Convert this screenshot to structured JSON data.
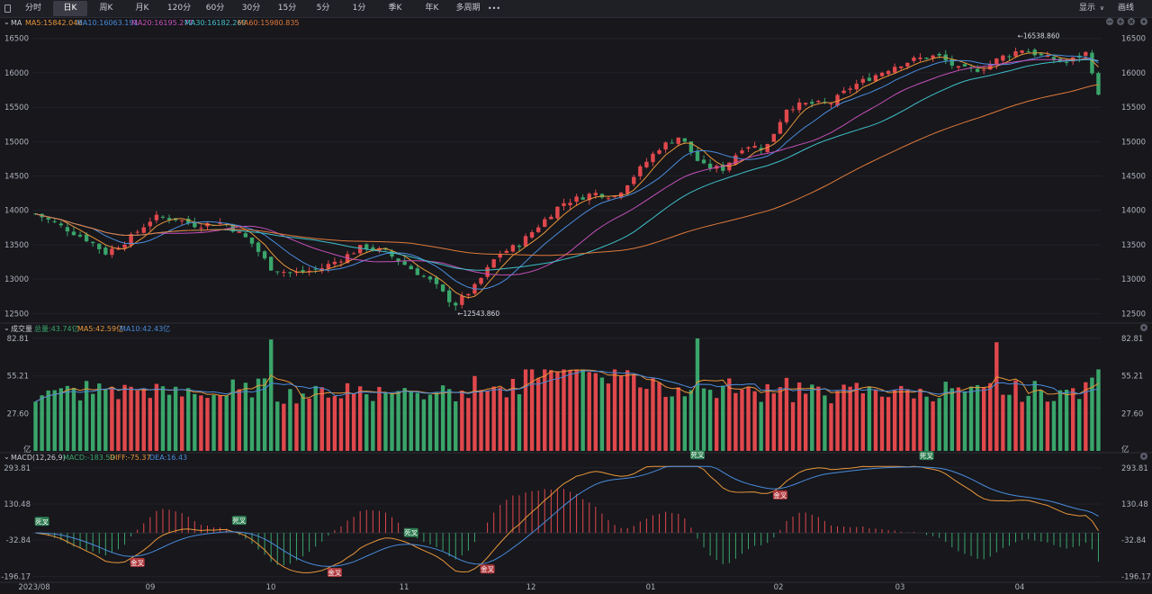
{
  "toolbar": {
    "tabs": [
      "分时",
      "日K",
      "周K",
      "月K",
      "120分",
      "60分",
      "30分",
      "15分",
      "5分",
      "1分",
      "季K",
      "年K",
      "多周期"
    ],
    "active": "日K",
    "more": "•••",
    "display": "显示",
    "display_arrow": "∨",
    "draw": "画线"
  },
  "colors": {
    "up": "#e0484c",
    "down": "#3aa56a",
    "ma5": "#e8963a",
    "ma10": "#4a8cdb",
    "ma20": "#c650b8",
    "ma30": "#40bfc9",
    "ma60": "#e07a3a",
    "bg": "#17171c"
  },
  "main": {
    "label": "MA",
    "legend": [
      {
        "text": "MA5:15842.046",
        "color": "#e8963a"
      },
      {
        "text": "MA10:16063.191",
        "color": "#4a8cdb"
      },
      {
        "text": "MA20:16195.277",
        "color": "#c650b8"
      },
      {
        "text": "MA30:16182.269",
        "color": "#40bfc9"
      },
      {
        "text": "MA60:15980.835",
        "color": "#e07a3a"
      }
    ],
    "yticks": [
      "16500",
      "16000",
      "15500",
      "15000",
      "14500",
      "14000",
      "13500",
      "13000",
      "12500"
    ],
    "high_label": "←16538.860",
    "low_label": "←12543.860"
  },
  "volume": {
    "label": "成交量",
    "legend": [
      {
        "text": "总量:43.74亿",
        "color": "#3aa56a"
      },
      {
        "text": "MA5:42.59亿",
        "color": "#e8963a"
      },
      {
        "text": "MA10:42.43亿",
        "color": "#4a8cdb"
      }
    ],
    "yticks": [
      "82.81",
      "55.21",
      "27.60"
    ],
    "unit": "亿"
  },
  "macd": {
    "label": "MACD(12,26,9)",
    "legend": [
      {
        "text": "MACD:-183.59",
        "color": "#3aa56a"
      },
      {
        "text": "DIFF:-75.37",
        "color": "#e8963a"
      },
      {
        "text": "DEA:16.43",
        "color": "#4a8cdb"
      }
    ],
    "yticks": [
      {
        "text": "293.81",
        "color": "#e0484c"
      },
      {
        "text": "130.48",
        "color": "#e0484c"
      },
      {
        "text": "-32.84",
        "color": "#3aa56a"
      },
      {
        "text": "-196.17",
        "color": "#3aa56a"
      }
    ],
    "gold": "金叉",
    "death": "死叉"
  },
  "xaxis": [
    "2023/08",
    "09",
    "10",
    "11",
    "12",
    "01",
    "02",
    "03",
    "04"
  ]
}
